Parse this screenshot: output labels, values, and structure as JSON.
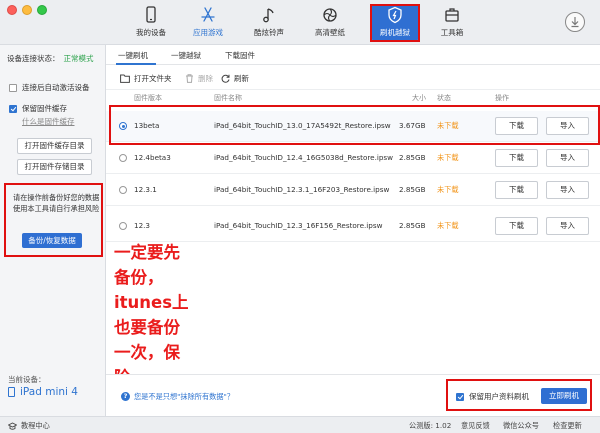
{
  "nav": {
    "items": [
      {
        "label": "我的设备",
        "icon": "phone-icon"
      },
      {
        "label": "应用游戏",
        "icon": "app-store-icon"
      },
      {
        "label": "酷炫铃声",
        "icon": "music-note-icon"
      },
      {
        "label": "高清壁纸",
        "icon": "pinwheel-icon"
      },
      {
        "label": "刷机越狱",
        "icon": "shield-icon"
      },
      {
        "label": "工具箱",
        "icon": "toolbox-icon"
      }
    ]
  },
  "sidebar": {
    "connection_label": "设备连接状态：",
    "connection_mode": "正常模式",
    "auto_activate": "连接后自动激活设备",
    "keep_cache": "保留固件缓存",
    "what_is_cache": "什么是固件缓存",
    "open_cache_dir": "打开固件缓存目录",
    "open_storage_dir": "打开固件存储目录",
    "warning_text": "请在操作前备份好您的数据 使用本工具请自行承担风险",
    "backup_button": "备份/恢复数据",
    "current_device_label": "当前设备：",
    "device_name": "iPad mini 4"
  },
  "tabs": {
    "items": [
      "一键刷机",
      "一键越狱",
      "下载固件"
    ]
  },
  "toolbar": {
    "open_folder": "打开文件夹",
    "delete": "删除",
    "refresh": "刷新"
  },
  "table": {
    "columns": {
      "version": "固件版本",
      "name": "固件名称",
      "size": "大小",
      "status": "状态",
      "action": "操作"
    },
    "download_label": "下载",
    "import_label": "导入",
    "rows": [
      {
        "version": "13beta",
        "name": "iPad_64bit_TouchID_13.0_17A5492t_Restore.ipsw",
        "size": "3.67GB",
        "status": "未下载",
        "selected": true
      },
      {
        "version": "12.4beta3",
        "name": "iPad_64bit_TouchID_12.4_16G5038d_Restore.ipsw",
        "size": "2.85GB",
        "status": "未下载",
        "selected": false
      },
      {
        "version": "12.3.1",
        "name": "iPad_64bit_TouchID_12.3.1_16F203_Restore.ipsw",
        "size": "2.85GB",
        "status": "未下载",
        "selected": false
      },
      {
        "version": "12.3",
        "name": "iPad_64bit_TouchID_12.3_16F156_Restore.ipsw",
        "size": "2.85GB",
        "status": "未下载",
        "selected": false
      }
    ]
  },
  "annotation": {
    "lines": [
      "一定要先",
      "备份，",
      "itunes上",
      "也要备份",
      "一次，保",
      "险"
    ]
  },
  "bottom": {
    "help_text": "您是不是只想\"抹除所有数据\"？",
    "keep_user_data": "保留用户资料刷机",
    "flash_now": "立即刷机"
  },
  "statusbar": {
    "tutorial": "教程中心",
    "version": "公测版: 1.02",
    "feedback": "意见反馈",
    "wechat": "微信公众号",
    "update": "检查更新"
  },
  "colors": {
    "accent": "#2f74d0",
    "annotation_red": "#e01010",
    "status_orange": "#f29418",
    "mode_green": "#2aa14a"
  }
}
